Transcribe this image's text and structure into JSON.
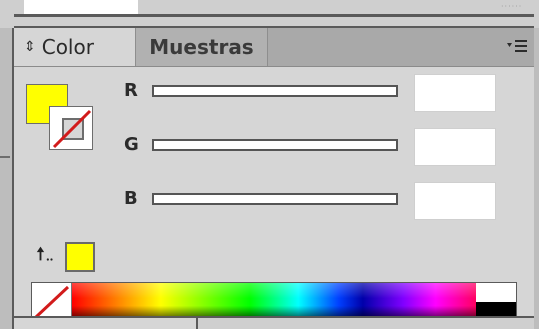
{
  "panel": {
    "tabs": [
      {
        "label": "Color",
        "active": true,
        "arrows_icon": "up-down-arrows-icon"
      },
      {
        "label": "Muestras",
        "active": false
      }
    ],
    "menu_icon": "panel-menu-icon"
  },
  "swatches": {
    "fill_color": "#ffff00",
    "stroke_state": "none",
    "out_of_gamut_color": "#ffff00",
    "out_of_gamut_icon": "out-of-gamut-warning-icon"
  },
  "rgb": {
    "r": {
      "label": "R",
      "value": ""
    },
    "g": {
      "label": "G",
      "value": ""
    },
    "b": {
      "label": "B",
      "value": ""
    }
  },
  "spectrum": {
    "none_icon": "none-color-icon",
    "white": "#ffffff",
    "black": "#000000"
  }
}
